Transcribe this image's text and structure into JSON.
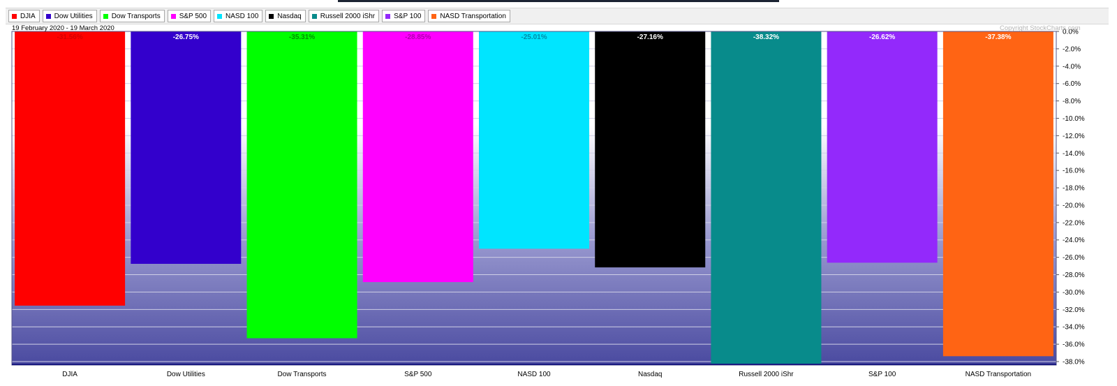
{
  "legend": [
    {
      "label": "DJIA",
      "color": "#ff0000"
    },
    {
      "label": "Dow Utilities",
      "color": "#3300cc"
    },
    {
      "label": "Dow Transports",
      "color": "#00ff00"
    },
    {
      "label": "S&P 500",
      "color": "#ff00ff"
    },
    {
      "label": "NASD 100",
      "color": "#00e5ff"
    },
    {
      "label": "Nasdaq",
      "color": "#000000"
    },
    {
      "label": "Russell 2000 iShr",
      "color": "#088b8b"
    },
    {
      "label": "S&P 100",
      "color": "#9329fb"
    },
    {
      "label": "NASD Transportation",
      "color": "#ff6414"
    }
  ],
  "header": {
    "period": "19 February 2020 - 19 March 2020",
    "copyright": "Copyright  StockCharts.com"
  },
  "chart_data": {
    "type": "bar",
    "categories": [
      "DJIA",
      "Dow Utilities",
      "Dow Transports",
      "S&P 500",
      "NASD 100",
      "Nasdaq",
      "Russell 2000 iShr",
      "S&P 100",
      "NASD Transportation"
    ],
    "values": [
      -31.56,
      -26.75,
      -35.31,
      -28.85,
      -25.01,
      -27.16,
      -38.32,
      -26.62,
      -37.38
    ],
    "value_labels": [
      "-31.56%",
      "-26.75%",
      "-35.31%",
      "-28.85%",
      "-25.01%",
      "-27.16%",
      "-38.32%",
      "-26.62%",
      "-37.38%"
    ],
    "colors": [
      "#ff0000",
      "#3300cc",
      "#00ff00",
      "#ff00ff",
      "#00e5ff",
      "#000000",
      "#088b8b",
      "#9329fb",
      "#ff6414"
    ],
    "label_colors": [
      "#d40000",
      "#ffffff",
      "#009000",
      "#b000b0",
      "#008ca8",
      "#ffffff",
      "#ffffff",
      "#ffffff",
      "#ffffff"
    ],
    "ylim": [
      -38.32,
      0
    ],
    "yticks": [
      0,
      -2,
      -4,
      -6,
      -8,
      -10,
      -12,
      -14,
      -16,
      -18,
      -20,
      -22,
      -24,
      -26,
      -28,
      -30,
      -32,
      -34,
      -36,
      -38
    ],
    "ytick_labels": [
      "0.0%",
      "-2.0%",
      "-4.0%",
      "-6.0%",
      "-8.0%",
      "-10.0%",
      "-12.0%",
      "-14.0%",
      "-16.0%",
      "-18.0%",
      "-20.0%",
      "-22.0%",
      "-24.0%",
      "-26.0%",
      "-28.0%",
      "-30.0%",
      "-32.0%",
      "-34.0%",
      "-36.0%",
      "-38.0%"
    ],
    "grid": true,
    "y_axis_side": "right",
    "title": "",
    "xlabel": "",
    "ylabel": ""
  }
}
